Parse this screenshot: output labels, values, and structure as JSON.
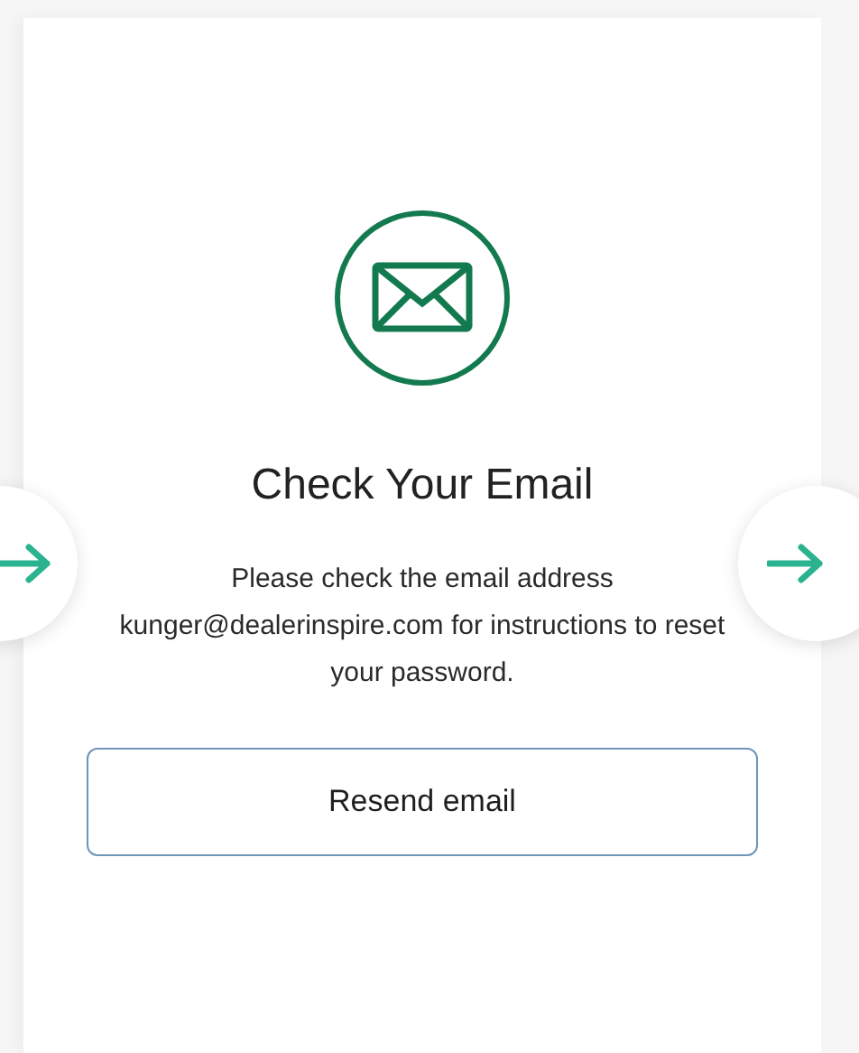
{
  "card": {
    "title": "Check Your Email",
    "message": "Please check the email address kunger@dealerinspire.com for instructions to reset your password.",
    "button": "Resend email"
  }
}
